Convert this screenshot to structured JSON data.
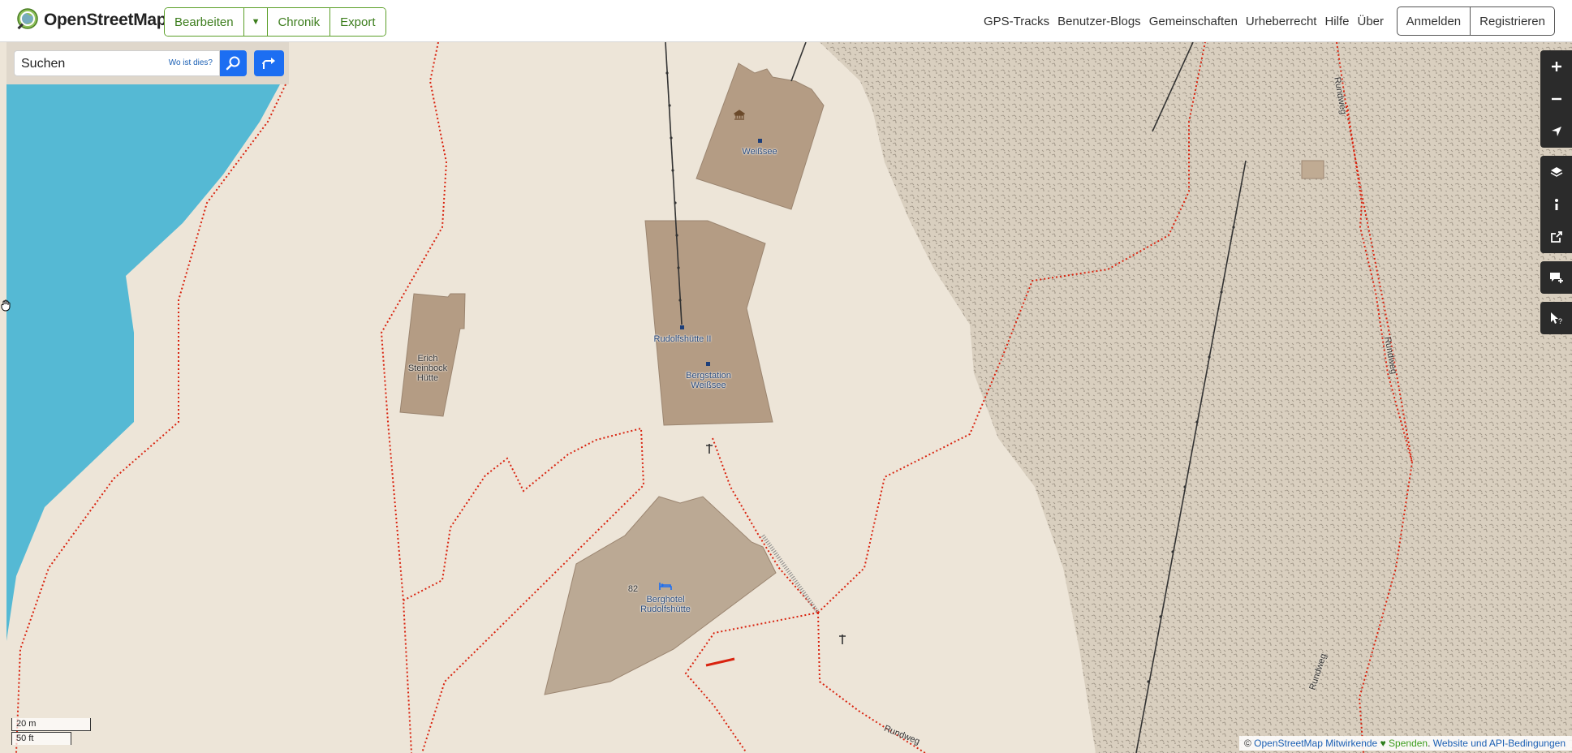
{
  "header": {
    "logo_text": "OpenStreetMap",
    "edit_label": "Bearbeiten",
    "history_label": "Chronik",
    "export_label": "Export",
    "nav": [
      "GPS-Tracks",
      "Benutzer-Blogs",
      "Gemeinschaften",
      "Urheberrecht",
      "Hilfe",
      "Über"
    ],
    "login_label": "Anmelden",
    "register_label": "Registrieren"
  },
  "search": {
    "placeholder": "Suchen",
    "where_label": "Wo ist dies?"
  },
  "map": {
    "labels": {
      "weisssee": "Weißsee",
      "rudolfshuette_ii": "Rudolfshütte II",
      "bergstation": "Bergstation Weißsee",
      "erich_steinbock": "Erich Steinbock Hütte",
      "berghotel": "Berghotel Rudolfshütte",
      "house_number": "82",
      "rundweg_1": "Rundweg",
      "rundweg_2": "Rundweg",
      "rundweg_3": "Rundweg",
      "rundweg_4": "Rundweg"
    },
    "colors": {
      "water": "#55b9d4",
      "land": "#ede5d8",
      "rock": "#dcd3c3",
      "building": "#b49c84",
      "path": "#d9230f"
    },
    "icons": [
      "museum-icon",
      "hotel-bed-icon",
      "summit-cross-icon"
    ]
  },
  "controls": {
    "buttons": [
      "zoom-in-icon",
      "zoom-out-icon",
      "locate-icon",
      "layers-icon",
      "info-icon",
      "share-icon",
      "note-icon",
      "query-icon"
    ]
  },
  "scale": {
    "metric": "20 m",
    "imperial": "50 ft"
  },
  "attribution": {
    "copyright": "©",
    "contributors": "OpenStreetMap Mitwirkende",
    "heart": "♥",
    "donate": "Spenden",
    "terms": "Website und API-Bedingungen"
  }
}
